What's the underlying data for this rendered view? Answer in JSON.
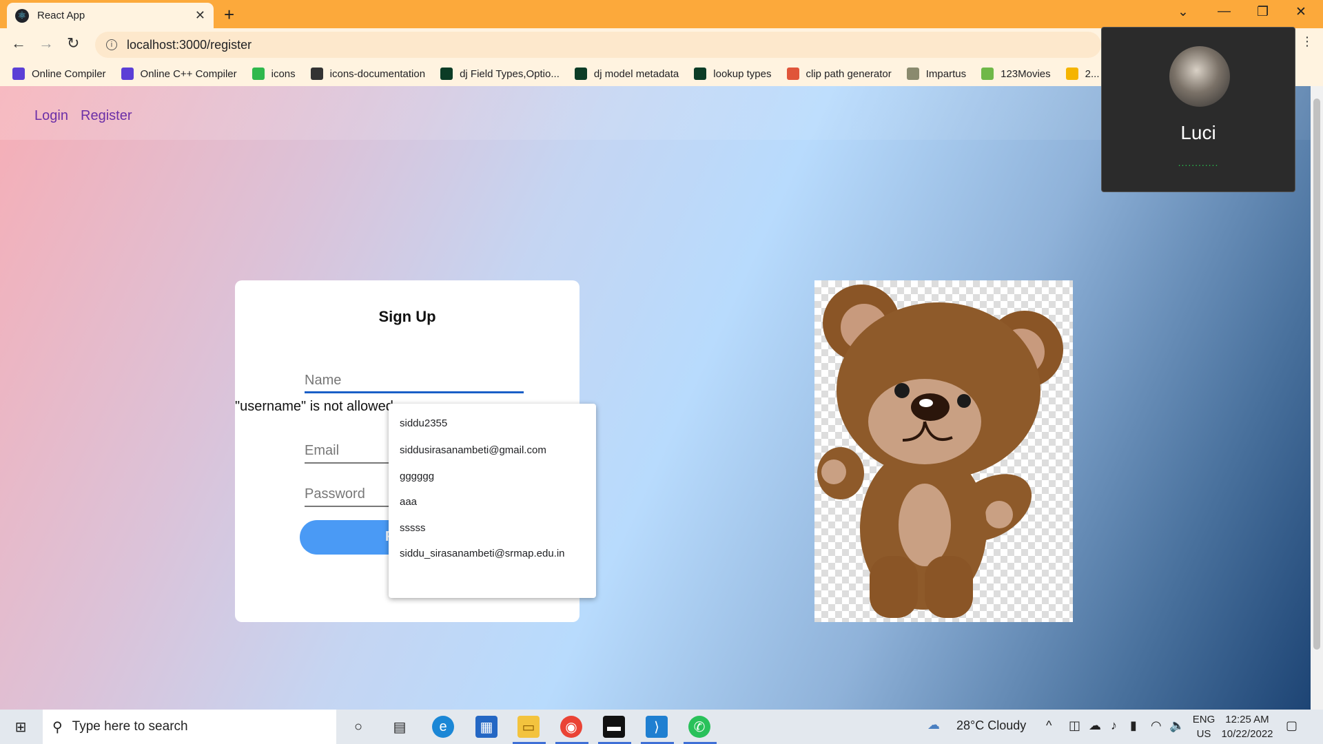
{
  "browser": {
    "tab_title": "React App",
    "url": "localhost:3000/register",
    "bookmarks": [
      {
        "label": "Online Compiler",
        "icon": "compiler-icon",
        "color": "#5b3fd6"
      },
      {
        "label": "Online C++ Compiler",
        "icon": "compiler-icon",
        "color": "#5b3fd6"
      },
      {
        "label": "icons",
        "icon": "icons-icon",
        "color": "#2fb84c"
      },
      {
        "label": "icons-documentation",
        "icon": "globe-icon",
        "color": "#333333"
      },
      {
        "label": "dj Field Types,Optio...",
        "icon": "django-icon",
        "color": "#0c3c26"
      },
      {
        "label": "dj model metadata",
        "icon": "django-icon",
        "color": "#0c3c26"
      },
      {
        "label": "lookup types",
        "icon": "django-icon",
        "color": "#0c3c26"
      },
      {
        "label": "clip path generator",
        "icon": "dots-icon",
        "color": "#e0553a"
      },
      {
        "label": "Impartus",
        "icon": "impartus-icon",
        "color": "#8a8a6e"
      },
      {
        "label": "123Movies",
        "icon": "movies-icon",
        "color": "#6fb848"
      },
      {
        "label": "2...",
        "icon": "drive-icon",
        "color": "#f5b400"
      }
    ]
  },
  "nav": {
    "login": "Login",
    "register": "Register"
  },
  "form": {
    "title": "Sign Up",
    "name_placeholder": "Name",
    "email_placeholder": "Email",
    "password_placeholder": "Password",
    "error_text": "\"username\" is not allowed",
    "submit_letter": "R"
  },
  "autocomplete": [
    "siddu2355",
    "siddusirasanambeti@gmail.com",
    "gggggg",
    "aaa",
    "sssss",
    "siddu_sirasanambeti@srmap.edu.in"
  ],
  "call": {
    "name": "Luci",
    "status_dots": "............"
  },
  "taskbar": {
    "search_placeholder": "Type here to search",
    "weather": "28°C  Cloudy",
    "lang": "ENG",
    "region": "US",
    "time": "12:25 AM",
    "date": "10/22/2022"
  },
  "colors": {
    "accent": "#4a9af5",
    "tabstrip": "#fca93b",
    "link": "#6b2fa7"
  }
}
